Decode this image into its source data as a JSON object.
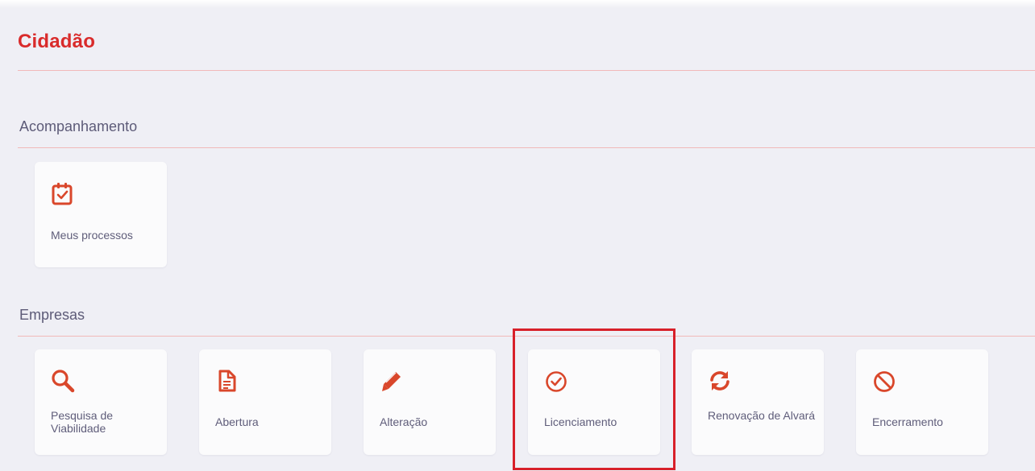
{
  "page": {
    "title": "Cidadão"
  },
  "accent_color": "#d9472b",
  "sections": [
    {
      "title": "Acompanhamento",
      "cards": [
        {
          "label": "Meus processos",
          "icon": "clipboard-check-icon"
        }
      ]
    },
    {
      "title": "Empresas",
      "cards": [
        {
          "label": "Pesquisa de Viabilidade",
          "icon": "search-icon"
        },
        {
          "label": "Abertura",
          "icon": "document-icon"
        },
        {
          "label": "Alteração",
          "icon": "pencil-icon"
        },
        {
          "label": "Licenciamento",
          "icon": "check-circle-icon"
        },
        {
          "label": "Renovação de Alvará",
          "icon": "refresh-icon"
        },
        {
          "label": "Encerramento",
          "icon": "ban-icon"
        }
      ]
    }
  ]
}
